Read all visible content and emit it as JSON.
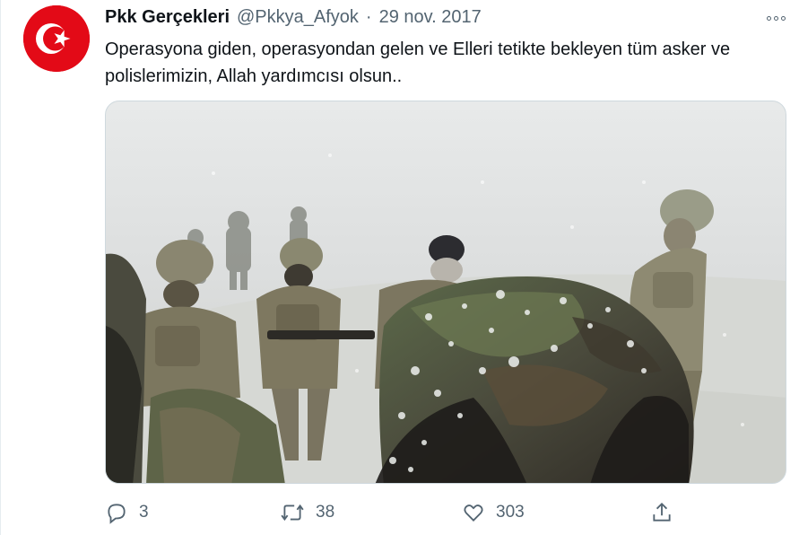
{
  "tweet": {
    "display_name": "Pkk Gerçekleri",
    "handle": "@Pkkya_Afyok",
    "separator": "·",
    "date": "29 nov. 2017",
    "text": "Operasyona giden, operasyondan gelen ve Elleri tetikte bekleyen tüm asker ve polislerimizin, Allah yardımcısı olsun..",
    "avatar_icon": "turkish-flag-icon",
    "media_description_icon": "photo"
  },
  "actions": {
    "reply_count": "3",
    "retweet_count": "38",
    "like_count": "303"
  },
  "colors": {
    "flag_red": "#e30a17",
    "text_primary": "#0f1419",
    "text_secondary": "#536471"
  }
}
